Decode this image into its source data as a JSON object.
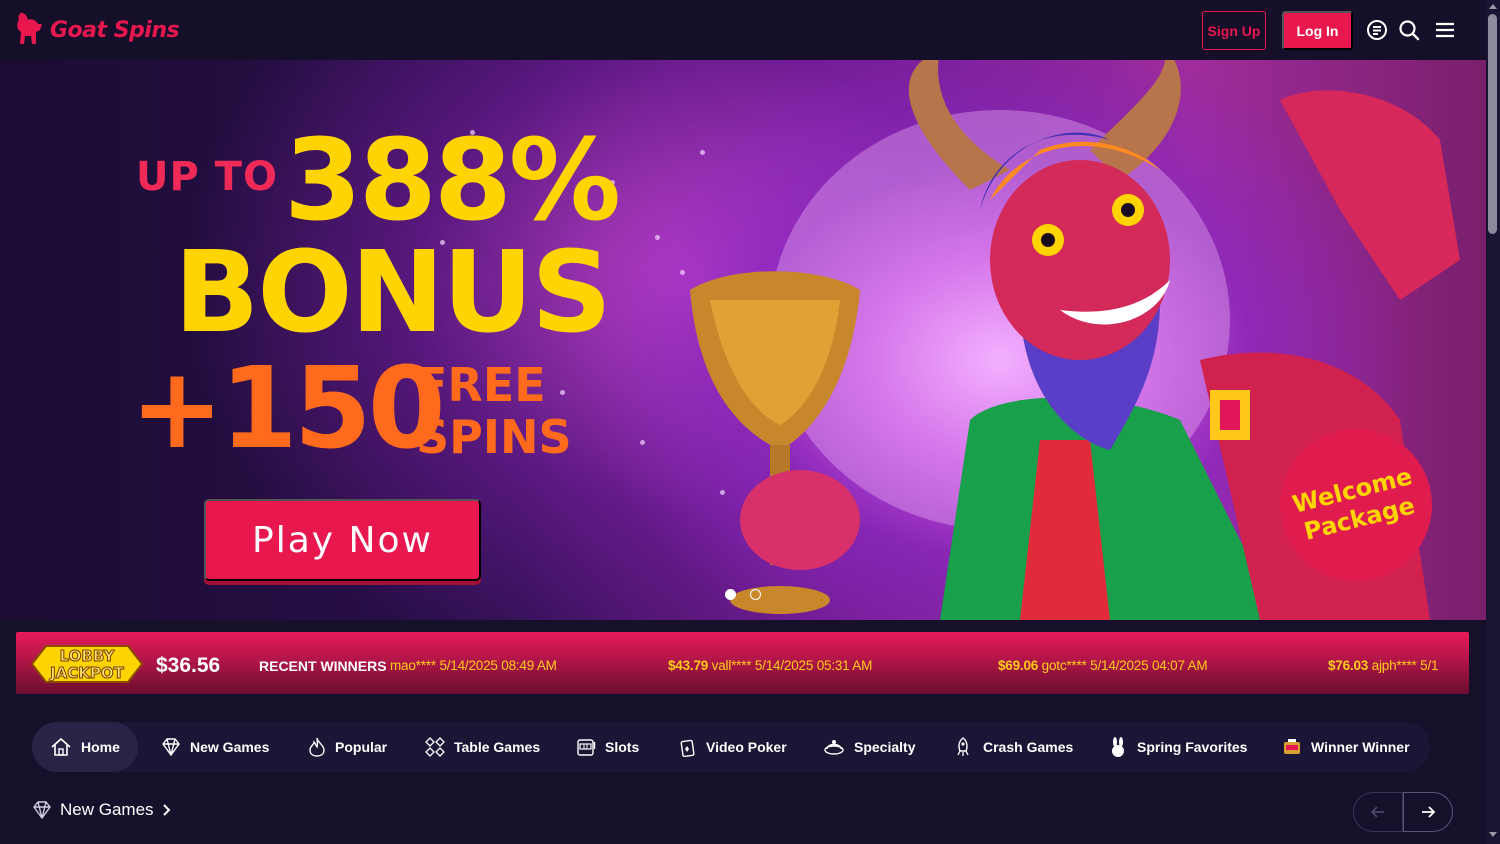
{
  "header": {
    "brand": "Goat Spins",
    "signup_label": "Sign Up",
    "login_label": "Log In",
    "icons": [
      "chat-icon",
      "search-icon",
      "menu-icon"
    ]
  },
  "hero": {
    "up_to": "UP TO",
    "percent": "388%",
    "bonus": "BONUS",
    "plus_spins": "+150",
    "free": "FREE",
    "spins": "SPINS",
    "cta_label": "Play Now",
    "badge_line1": "Welcome",
    "badge_line2": "Package",
    "slides": 2,
    "active_slide": 1
  },
  "ticker": {
    "jackpot_logo_line1": "LOBBY",
    "jackpot_logo_line2": "JACKPOT",
    "jackpot_amount": "$36.56",
    "recent_label": "RECENT WINNERS",
    "winners": [
      {
        "amount": "",
        "user": "mao****",
        "time": "5/14/2025 08:49 AM"
      },
      {
        "amount": "$43.79",
        "user": "vall****",
        "time": "5/14/2025 05:31 AM"
      },
      {
        "amount": "$69.06",
        "user": "gotc****",
        "time": "5/14/2025 04:07 AM"
      },
      {
        "amount": "$76.03",
        "user": "ajph****",
        "time": "5/1"
      }
    ]
  },
  "categories": [
    {
      "label": "Home",
      "icon": "home-icon",
      "active": true
    },
    {
      "label": "New Games",
      "icon": "diamond-icon"
    },
    {
      "label": "Popular",
      "icon": "flame-icon"
    },
    {
      "label": "Table Games",
      "icon": "cards-icon"
    },
    {
      "label": "Slots",
      "icon": "slot-machine-icon"
    },
    {
      "label": "Video Poker",
      "icon": "poker-icon"
    },
    {
      "label": "Specialty",
      "icon": "specialty-icon"
    },
    {
      "label": "Crash Games",
      "icon": "rocket-icon"
    },
    {
      "label": "Spring Favorites",
      "icon": "bunny-icon"
    },
    {
      "label": "Winner Winner",
      "icon": "winner-icon"
    }
  ],
  "section": {
    "title": "New Games",
    "icon": "diamond-icon"
  },
  "colors": {
    "brand": "#e8184f",
    "bonus_yellow": "#ffd400",
    "spins_orange": "#ff6a1d",
    "background": "#16102b"
  }
}
